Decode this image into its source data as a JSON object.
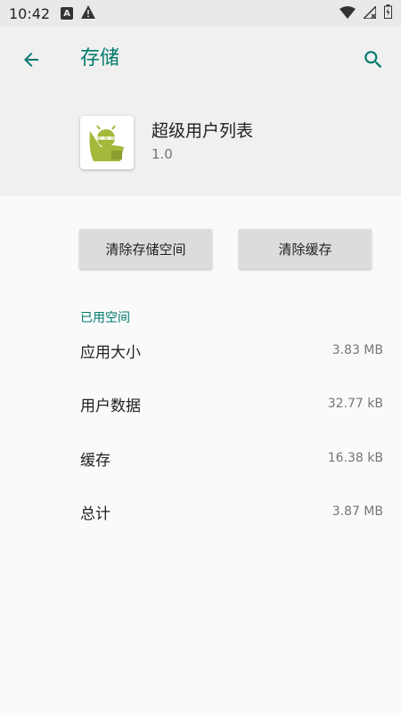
{
  "status_bar": {
    "time": "10:42",
    "notif_icon_letter": "A"
  },
  "toolbar": {
    "title": "存储",
    "accent_color": "#00796b"
  },
  "app": {
    "name": "超级用户列表",
    "version": "1.0"
  },
  "buttons": {
    "clear_storage": "清除存储空间",
    "clear_cache": "清除缓存"
  },
  "storage": {
    "section_title": "已用空间",
    "rows": [
      {
        "label": "应用大小",
        "value": "3.83 MB"
      },
      {
        "label": "用户数据",
        "value": "32.77 kB"
      },
      {
        "label": "缓存",
        "value": "16.38 kB"
      },
      {
        "label": "总计",
        "value": "3.87 MB"
      }
    ]
  }
}
